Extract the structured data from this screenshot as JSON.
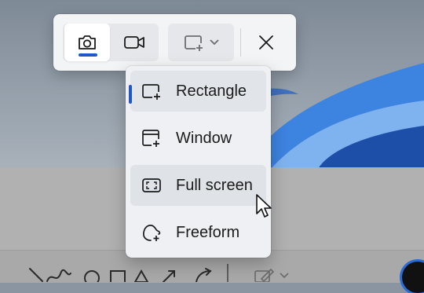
{
  "snip_toolbar": {
    "modes": [
      {
        "name": "photo",
        "icon": "camera-icon",
        "selected": true
      },
      {
        "name": "video",
        "icon": "video-camera-icon",
        "selected": false
      }
    ],
    "shape_button_icon": "rectangle-snip-icon",
    "close_icon": "close-icon"
  },
  "snip_menu": {
    "items": [
      {
        "label": "Rectangle",
        "icon": "rectangle-snip-icon",
        "selected": true
      },
      {
        "label": "Window",
        "icon": "window-snip-icon",
        "selected": false
      },
      {
        "label": "Full screen",
        "icon": "full-screen-snip-icon",
        "selected": false,
        "hovered": true
      },
      {
        "label": "Freeform",
        "icon": "freeform-snip-icon",
        "selected": false
      }
    ]
  },
  "colors": {
    "accent": "#1f57c7",
    "toolbar_bg": "#f3f4f6",
    "menu_bg": "#eef0f3",
    "wallpaper_blue": "#2f6fd0"
  }
}
